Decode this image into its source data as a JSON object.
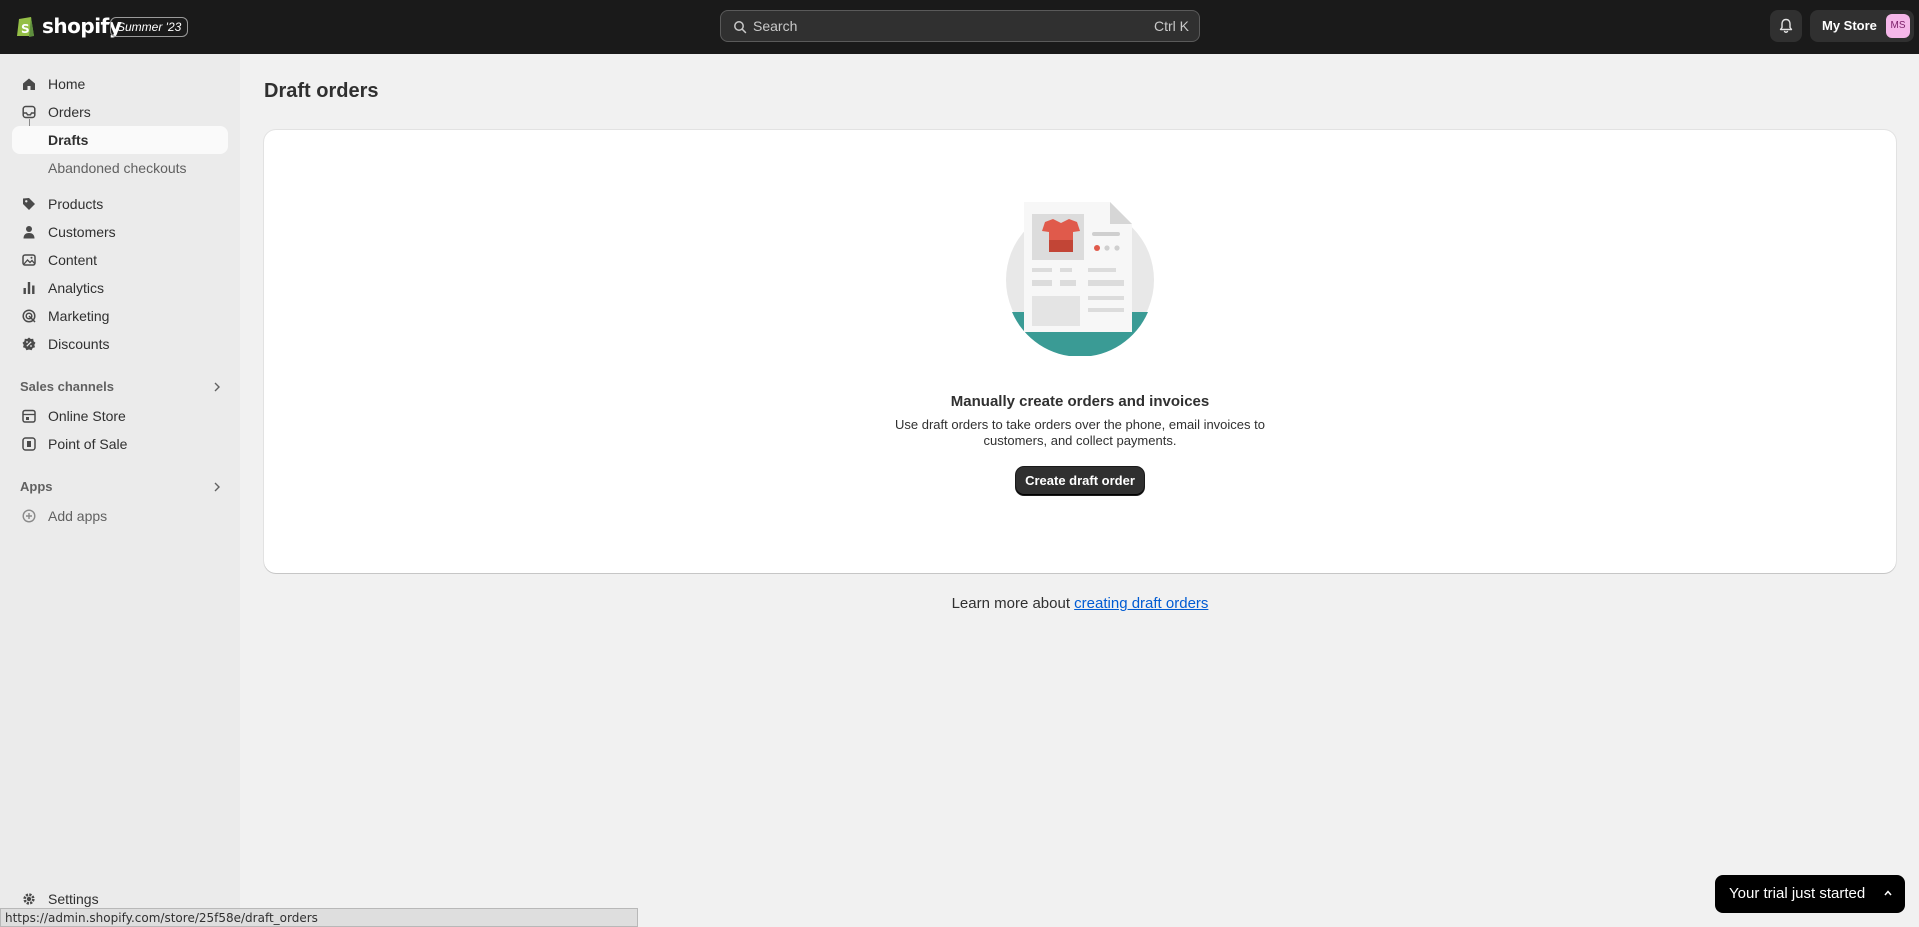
{
  "topbar": {
    "brand": "shopify",
    "season_badge": "Summer '23",
    "search_placeholder": "Search",
    "search_shortcut": "Ctrl K",
    "store_name": "My Store",
    "avatar_initials": "MS"
  },
  "sidebar": {
    "items": [
      {
        "label": "Home",
        "icon": "home-icon"
      },
      {
        "label": "Orders",
        "icon": "inbox-icon"
      },
      {
        "label": "Drafts"
      },
      {
        "label": "Abandoned checkouts"
      },
      {
        "label": "Products",
        "icon": "tag-icon"
      },
      {
        "label": "Customers",
        "icon": "person-icon"
      },
      {
        "label": "Content",
        "icon": "image-icon"
      },
      {
        "label": "Analytics",
        "icon": "bar-chart-icon"
      },
      {
        "label": "Marketing",
        "icon": "target-icon"
      },
      {
        "label": "Discounts",
        "icon": "discount-icon"
      }
    ],
    "sales_channels": {
      "heading": "Sales channels",
      "items": [
        {
          "label": "Online Store",
          "icon": "store-icon"
        },
        {
          "label": "Point of Sale",
          "icon": "pos-icon"
        }
      ]
    },
    "apps": {
      "heading": "Apps",
      "items": [
        {
          "label": "Add apps",
          "icon": "plus-circle-icon"
        }
      ]
    },
    "settings_label": "Settings"
  },
  "main": {
    "title": "Draft orders",
    "empty_state": {
      "heading": "Manually create orders and invoices",
      "description": "Use draft orders to take orders over the phone, email invoices to customers, and collect payments.",
      "button_label": "Create draft order"
    },
    "learn_more_prefix": "Learn more about ",
    "learn_more_link": "creating draft orders"
  },
  "status_url": "https://admin.shopify.com/store/25f58e/draft_orders",
  "trial_banner": "Your trial just started",
  "colors": {
    "topbar_bg": "#1a1a1a",
    "page_bg": "#f1f1f1",
    "sidebar_bg": "#ebebeb",
    "primary_button": "#303030",
    "link": "#005bd3",
    "illustration_teal": "#3a9b95",
    "illustration_red": "#e05a4b"
  }
}
